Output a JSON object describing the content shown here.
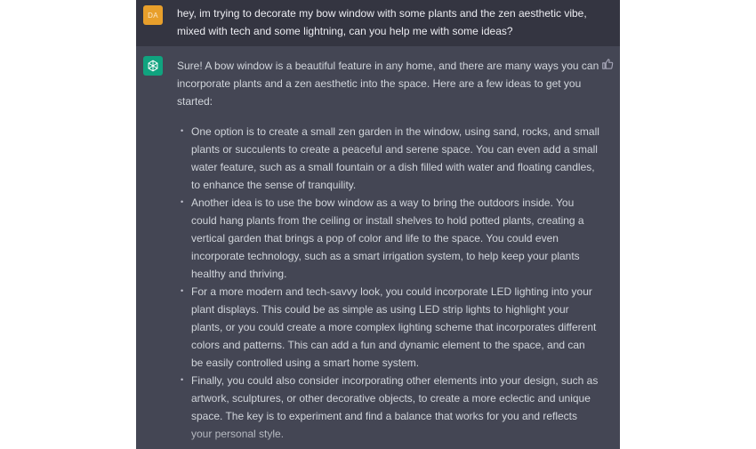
{
  "user_message": {
    "avatar_initials": "DA",
    "text": "hey, im trying to decorate my bow window with some plants and the zen aesthetic vibe, mixed with tech and some lightning, can you help me with some ideas?"
  },
  "assistant_message": {
    "intro": "Sure! A bow window is a beautiful feature in any home, and there are many ways you can incorporate plants and a zen aesthetic into the space. Here are a few ideas to get you started:",
    "ideas": [
      "One option is to create a small zen garden in the window, using sand, rocks, and small plants or succulents to create a peaceful and serene space. You can even add a small water feature, such as a small fountain or a dish filled with water and floating candles, to enhance the sense of tranquility.",
      "Another idea is to use the bow window as a way to bring the outdoors inside. You could hang plants from the ceiling or install shelves to hold potted plants, creating a vertical garden that brings a pop of color and life to the space. You could even incorporate technology, such as a smart irrigation system, to help keep your plants healthy and thriving.",
      "For a more modern and tech-savvy look, you could incorporate LED lighting into your plant displays. This could be as simple as using LED strip lights to highlight your plants, or you could create a more complex lighting scheme that incorporates different colors and patterns. This can add a fun and dynamic element to the space, and can be easily controlled using a smart home system.",
      "Finally, you could also consider incorporating other elements into your design, such as artwork, sculptures, or other decorative objects, to create a more eclectic and unique space. The key is to experiment and find a balance that works for you and reflects your personal style."
    ]
  },
  "icons": {
    "assistant_avatar": "openai-logo-icon",
    "feedback": "thumbs-up-icon"
  },
  "colors": {
    "user_bg": "#343541",
    "assistant_bg": "#444654",
    "user_avatar": "#e89f2b",
    "assistant_avatar": "#10a37f"
  }
}
